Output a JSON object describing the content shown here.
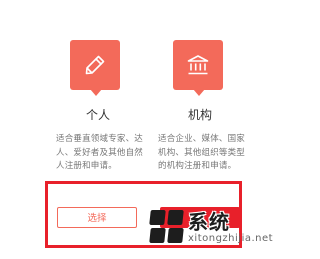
{
  "cards": [
    {
      "title": "个人",
      "icon": "pencil-icon",
      "description": "适合垂直领域专家、达人、爱好者及其他自然人注册和申请。",
      "button_label": "选择"
    },
    {
      "title": "机构",
      "icon": "bank-building-icon",
      "description": "适合企业、媒体、国家机构、其他组织等类型的机构注册和申请。"
    }
  ],
  "watermark": {
    "title": "系统",
    "subtitle": "xitongzhijia.net"
  },
  "colors": {
    "accent": "#f36a5a",
    "highlight_frame": "#e8202a"
  }
}
